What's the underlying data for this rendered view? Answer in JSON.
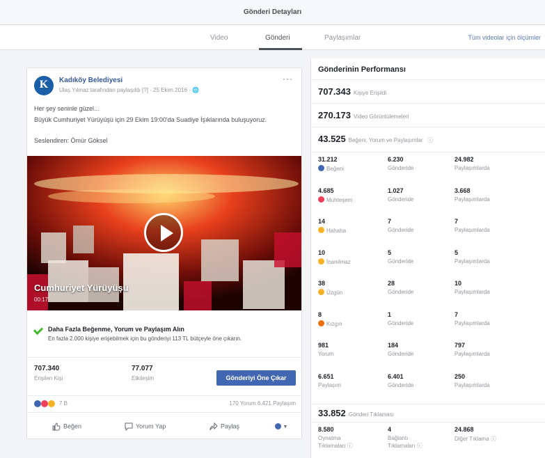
{
  "window": {
    "title": "Gönderi Detayları"
  },
  "tabs": [
    {
      "label": "Video"
    },
    {
      "label": "Gönderi"
    },
    {
      "label": "Paylaşımlar"
    }
  ],
  "tabs_right_link": "Tüm videolar için ölçümler",
  "post": {
    "page_name": "Kadıköy Belediyesi",
    "meta": "Ulaş Yılmaz tarafından paylaşıldı [?] · 25 Ekim 2016 · ",
    "more_label": "···",
    "line1": "Her şey seninle güzel...",
    "line2": "Büyük Cumhuriyet Yürüyüşü için 29 Ekim 19:00'da Suadiye İşıklarında buluşuyoruz.",
    "line3": "Seslendiren: Ömür Göksel",
    "video_title": "Cumhuriyet Yürüyüşü",
    "video_duration": "00:17",
    "boost_title": "Daha Fazla Beğenme, Yorum ve Paylaşım Alın",
    "boost_text": "En fazla 2.000 kişiye erişebilmek için bu gönderiyi 113 TL bütçeyle öne çıkarın.",
    "reached_value": "707.340",
    "reached_label": "Erişilen Kişi",
    "engagement_value": "77.077",
    "engagement_label": "Etkileşim",
    "boost_button": "Gönderiyi Öne Çıkar",
    "reaction_count": "7 B",
    "comments_shares": "170 Yorum  6.421 Paylaşım",
    "actions": {
      "like": "Beğen",
      "comment": "Yorum Yap",
      "share": "Paylaş"
    }
  },
  "performance": {
    "heading": "Gönderinin Performansı",
    "reach_value": "707.343",
    "reach_label": "Kişiye Erişildi",
    "views_value": "270.173",
    "views_label": "Video Görüntülemeleri",
    "engagement_value": "43.525",
    "engagement_label": "Beğeni, Yorum ve Paylaşımlar",
    "rows": [
      {
        "total": "31.212",
        "label": "Beğeni",
        "icon": "like",
        "on_post": "6.230",
        "on_post_label": "Gönderide",
        "on_shares": "24.982",
        "on_shares_label": "Paylaşımlarda"
      },
      {
        "total": "4.685",
        "label": "Muhteşem",
        "icon": "love",
        "on_post": "1.027",
        "on_post_label": "Gönderide",
        "on_shares": "3.668",
        "on_shares_label": "Paylaşımlarda"
      },
      {
        "total": "14",
        "label": "Hahaha",
        "icon": "haha",
        "on_post": "7",
        "on_post_label": "Gönderide",
        "on_shares": "7",
        "on_shares_label": "Paylaşımlarda"
      },
      {
        "total": "10",
        "label": "İnanılmaz",
        "icon": "wow",
        "on_post": "5",
        "on_post_label": "Gönderide",
        "on_shares": "5",
        "on_shares_label": "Paylaşımlarda"
      },
      {
        "total": "38",
        "label": "Üzgün",
        "icon": "sad",
        "on_post": "28",
        "on_post_label": "Gönderide",
        "on_shares": "10",
        "on_shares_label": "Paylaşımlarda"
      },
      {
        "total": "8",
        "label": "Kızgın",
        "icon": "angry",
        "on_post": "1",
        "on_post_label": "Gönderide",
        "on_shares": "7",
        "on_shares_label": "Paylaşımlarda"
      },
      {
        "total": "981",
        "label": "Yorum",
        "icon": "",
        "on_post": "184",
        "on_post_label": "Gönderide",
        "on_shares": "797",
        "on_shares_label": "Paylaşımlarda"
      },
      {
        "total": "6.651",
        "label": "Paylaşım",
        "icon": "",
        "on_post": "6.401",
        "on_post_label": "Gönderide",
        "on_shares": "250",
        "on_shares_label": "Paylaşımlarda"
      }
    ],
    "clicks_value": "33.852",
    "clicks_label": "Gönderi Tıklaması",
    "clicks": [
      {
        "value": "8.580",
        "label1": "Oynatma",
        "label2": "Tıklamaları"
      },
      {
        "value": "4",
        "label1": "Bağlantı",
        "label2": "Tıklamaları"
      },
      {
        "value": "24.868",
        "label1": "Diğer Tıklama",
        "label2": ""
      }
    ],
    "info_glyph": "ⓘ"
  }
}
